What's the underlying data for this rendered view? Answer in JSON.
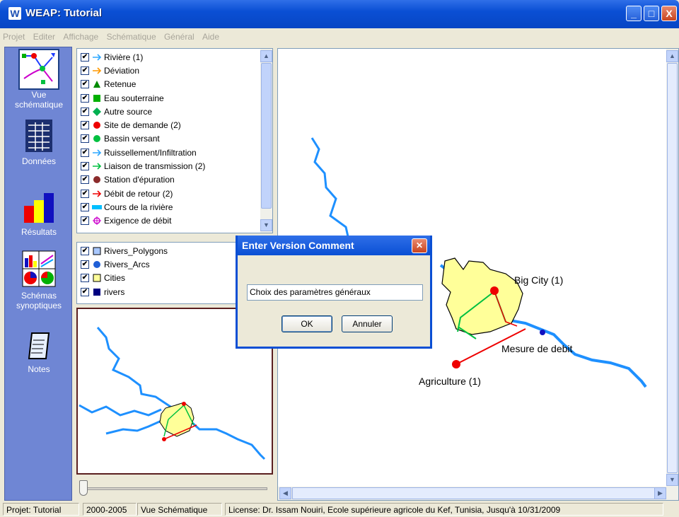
{
  "window": {
    "app_letter": "W",
    "title": "WEAP: Tutorial",
    "min": "_",
    "max": "□",
    "close": "X"
  },
  "menu": [
    "Projet",
    "Editer",
    "Affichage",
    "Schématique",
    "Général",
    "Aide"
  ],
  "nav": [
    {
      "label1": "Vue",
      "label2": "schématique",
      "icon": "schematic-icon"
    },
    {
      "label1": "Données",
      "label2": "",
      "icon": "data-table-icon"
    },
    {
      "label1": "Résultats",
      "label2": "",
      "icon": "bar-chart-icon"
    },
    {
      "label1": "Schémas",
      "label2": "synoptiques",
      "icon": "overview-charts-icon"
    },
    {
      "label1": "Notes",
      "label2": "",
      "icon": "notepad-icon"
    }
  ],
  "layers": [
    {
      "label": "Rivière (1)",
      "symbol": "arrow",
      "color": "#2fa8ff"
    },
    {
      "label": "Déviation",
      "symbol": "arrow",
      "color": "#ff9900"
    },
    {
      "label": "Retenue",
      "symbol": "triangle",
      "color": "#008a00"
    },
    {
      "label": "Eau souterraine",
      "symbol": "square",
      "color": "#00b000"
    },
    {
      "label": "Autre source",
      "symbol": "diamond",
      "color": "#00b050"
    },
    {
      "label": "Site de demande (2)",
      "symbol": "circle",
      "color": "#ee0000"
    },
    {
      "label": "Bassin versant",
      "symbol": "circle",
      "color": "#00c040"
    },
    {
      "label": "Ruissellement/Infiltration",
      "symbol": "arrow",
      "color": "#2fa8ff"
    },
    {
      "label": "Liaison de transmission (2)",
      "symbol": "arrow",
      "color": "#00c040"
    },
    {
      "label": "Station d'épuration",
      "symbol": "circle",
      "color": "#8b2b2b"
    },
    {
      "label": "Débit de retour (2)",
      "symbol": "arrow",
      "color": "#ee0000"
    },
    {
      "label": "Cours de la rivière",
      "symbol": "bar",
      "color": "#00bfff"
    },
    {
      "label": "Exigence de débit",
      "symbol": "target",
      "color": "#cc00cc"
    }
  ],
  "gis_layers": [
    {
      "label": "Rivers_Polygons",
      "symbol": "square-outline",
      "color": "#a9c8ff"
    },
    {
      "label": "Rivers_Arcs",
      "symbol": "circle",
      "color": "#1f5fd6"
    },
    {
      "label": "Cities",
      "symbol": "square-outline",
      "color": "#ffff99"
    },
    {
      "label": "rivers",
      "symbol": "square",
      "color": "#000080"
    }
  ],
  "map": {
    "labels": {
      "big_city": "Big City (1)",
      "gauge": "Mesure de debit",
      "agri": "Agriculture (1)"
    },
    "colors": {
      "river": "#1e90ff",
      "city_fill": "#ffff99",
      "demand": "#ee0000",
      "link": "#00c040",
      "return": "#ee0000"
    }
  },
  "dialog": {
    "title": "Enter Version Comment",
    "input_value": "Choix des paramètres généraux",
    "ok": "OK",
    "cancel": "Annuler"
  },
  "status": {
    "project": "Projet: Tutorial",
    "years": "2000-2005",
    "view": "Vue Schématique",
    "license": "License: Dr. Issam Nouiri, Ecole supérieure agricole du Kef, Tunisia, Jusqu'à 10/31/2009"
  }
}
